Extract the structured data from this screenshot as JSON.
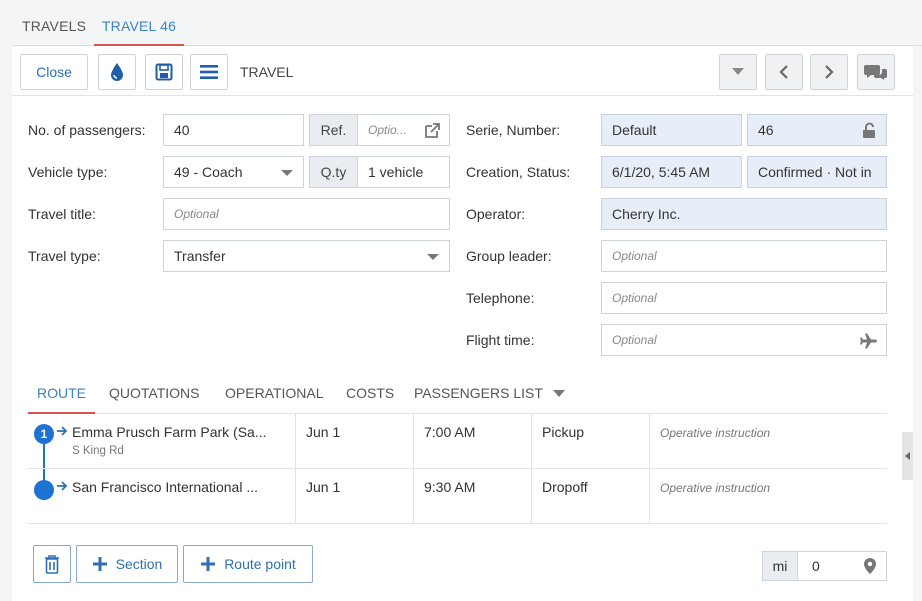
{
  "top_tabs": [
    {
      "label": "TRAVELS"
    },
    {
      "label": "TRAVEL 46"
    }
  ],
  "toolbar": {
    "close_label": "Close",
    "section_label": "TRAVEL"
  },
  "form": {
    "passengers": {
      "label": "No. of passengers:",
      "value": "40",
      "ref_addon": "Ref.",
      "ref_placeholder": "Optio..."
    },
    "vehicle": {
      "label": "Vehicle type:",
      "value": "49 - Coach",
      "qty_addon": "Q.ty",
      "qty_value": "1 vehicle"
    },
    "title": {
      "label": "Travel title:",
      "placeholder": "Optional"
    },
    "type": {
      "label": "Travel type:",
      "value": "Transfer"
    },
    "serie": {
      "label": "Serie, Number:",
      "serie_value": "Default",
      "number_value": "46"
    },
    "creation": {
      "label": "Creation, Status:",
      "date_value": "6/1/20, 5:45 AM",
      "status_value": "Confirmed · Not in"
    },
    "operator": {
      "label": "Operator:",
      "value": "Cherry Inc."
    },
    "group_leader": {
      "label": "Group leader:",
      "placeholder": "Optional"
    },
    "telephone": {
      "label": "Telephone:",
      "placeholder": "Optional"
    },
    "flight_time": {
      "label": "Flight time:",
      "placeholder": "Optional"
    }
  },
  "sub_tabs": [
    {
      "label": "ROUTE"
    },
    {
      "label": "QUOTATIONS"
    },
    {
      "label": "OPERATIONAL"
    },
    {
      "label": "COSTS"
    },
    {
      "label": "PASSENGERS LIST"
    }
  ],
  "route": [
    {
      "index": "1",
      "place": "Emma Prusch Farm Park (Sa...",
      "address": "S King Rd",
      "date": "Jun 1",
      "time": "7:00 AM",
      "kind": "Pickup",
      "instruction": "Operative instruction"
    },
    {
      "index": "",
      "place": "San Francisco International ...",
      "address": "",
      "date": "Jun 1",
      "time": "9:30 AM",
      "kind": "Dropoff",
      "instruction": "Operative instruction"
    }
  ],
  "bottom": {
    "section_label": "Section",
    "route_point_label": "Route point",
    "unit": "mi",
    "distance": "0"
  },
  "colors": {
    "accent": "#3b83c9",
    "tab_underline": "#d9534f",
    "route_blue": "#1e73d2"
  }
}
